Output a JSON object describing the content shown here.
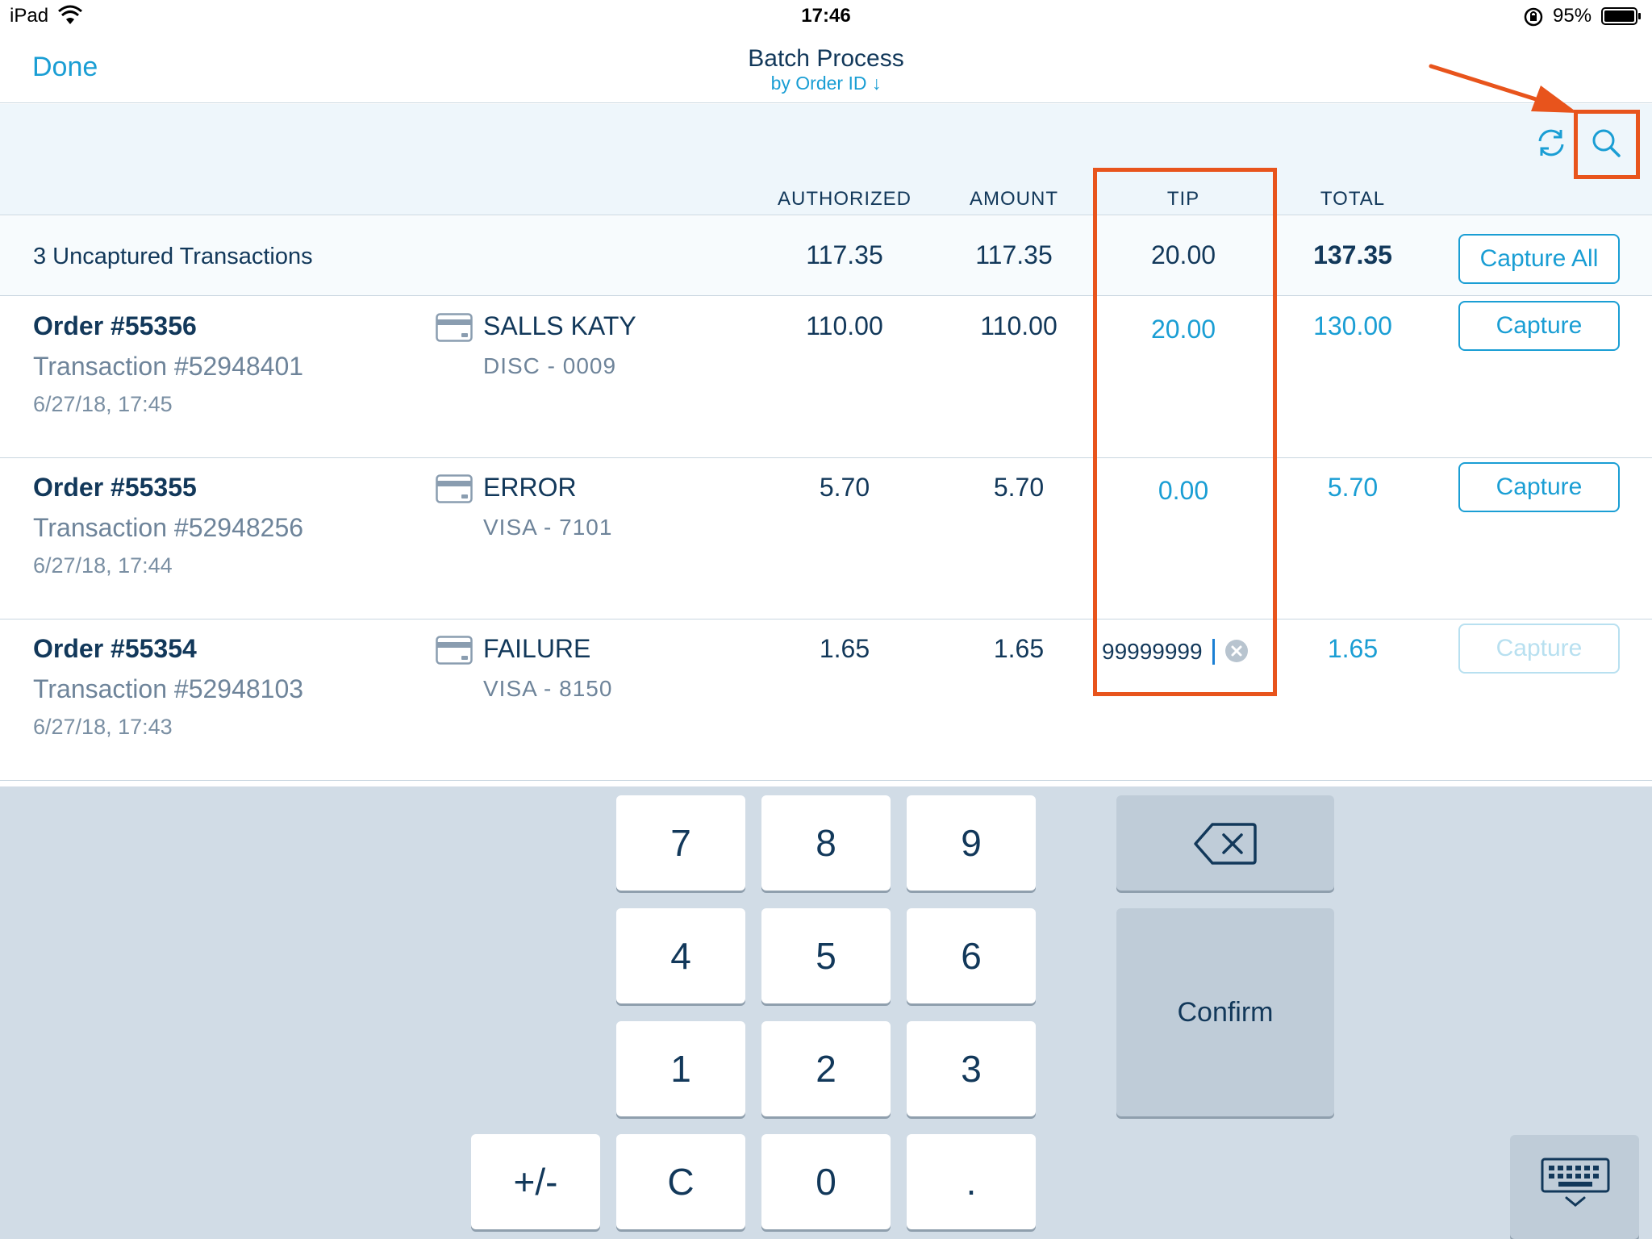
{
  "status_bar": {
    "device": "iPad",
    "time": "17:46",
    "battery": "95%"
  },
  "nav": {
    "done": "Done",
    "title": "Batch Process",
    "subtitle": "by Order ID ↓"
  },
  "columns": {
    "authorized": "AUTHORIZED",
    "amount": "AMOUNT",
    "tip": "TIP",
    "total": "TOTAL"
  },
  "summary": {
    "label": "3 Uncaptured Transactions",
    "authorized": "117.35",
    "amount": "117.35",
    "tip": "20.00",
    "total": "137.35",
    "capture_all": "Capture All"
  },
  "rows": [
    {
      "order": "Order #55356",
      "transaction": "Transaction #52948401",
      "date": "6/27/18, 17:45",
      "name": "SALLS KATY",
      "card": "DISC - 0009",
      "authorized": "110.00",
      "amount": "110.00",
      "tip": "20.00",
      "total": "130.00",
      "capture": "Capture"
    },
    {
      "order": "Order #55355",
      "transaction": "Transaction #52948256",
      "date": "6/27/18, 17:44",
      "name": "ERROR",
      "card": "VISA - 7101",
      "authorized": "5.70",
      "amount": "5.70",
      "tip": "0.00",
      "total": "5.70",
      "capture": "Capture"
    },
    {
      "order": "Order #55354",
      "transaction": "Transaction #52948103",
      "date": "6/27/18, 17:43",
      "name": "FAILURE",
      "card": "VISA - 8150",
      "authorized": "1.65",
      "amount": "1.65",
      "tip": "99999999",
      "total": "1.65",
      "capture": "Capture"
    }
  ],
  "keypad": {
    "keys": [
      "7",
      "8",
      "9",
      "4",
      "5",
      "6",
      "1",
      "2",
      "3",
      "+/-",
      "C",
      "0",
      "."
    ],
    "confirm": "Confirm"
  },
  "colors": {
    "accent": "#1a9ed4",
    "highlight": "#e8541c",
    "text": "#12385a"
  }
}
